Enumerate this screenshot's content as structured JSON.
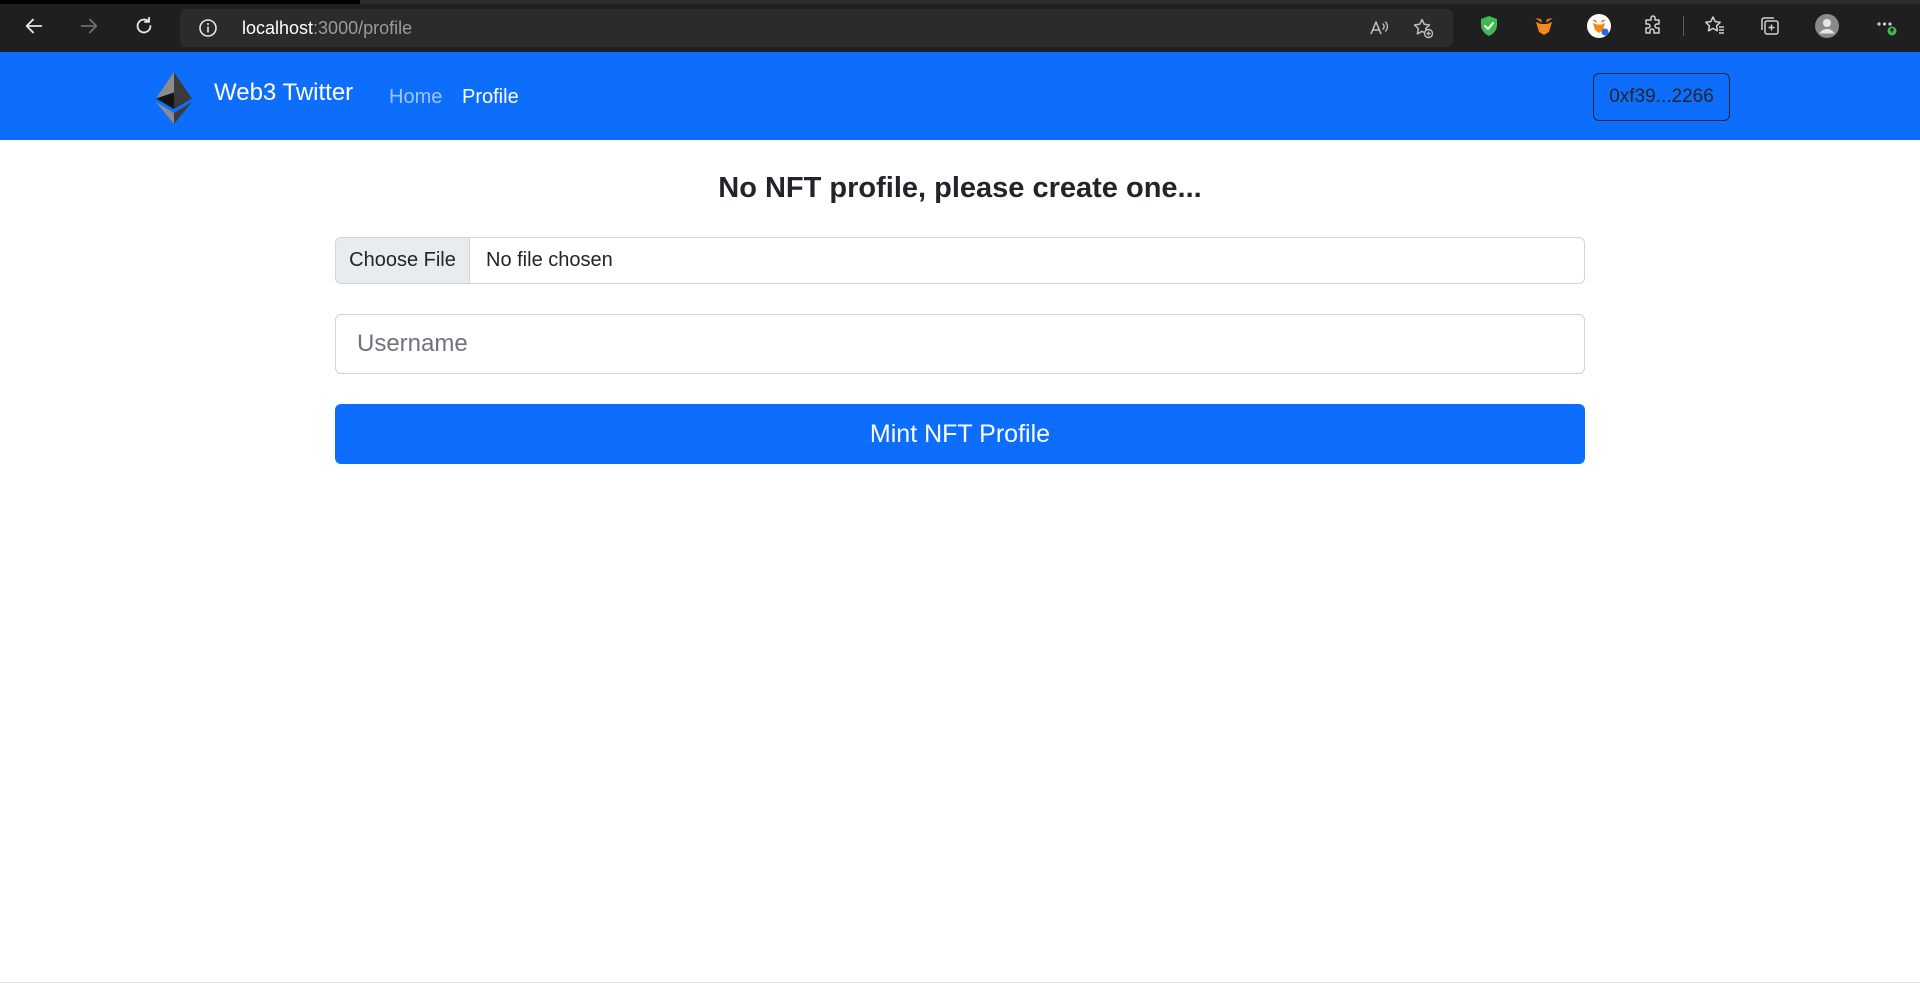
{
  "browser": {
    "url_host": "localhost",
    "url_path": ":3000/profile",
    "icons": [
      "back-icon",
      "forward-icon",
      "reload-icon",
      "site-info-icon",
      "read-aloud-icon",
      "add-favorite-icon",
      "shield-extension-icon",
      "metamask-icon",
      "metamask-account-icon",
      "extensions-icon",
      "favorites-icon",
      "collections-icon",
      "profile-icon",
      "more-icon"
    ]
  },
  "navbar": {
    "brand": "Web3 Twitter",
    "links": [
      {
        "label": "Home"
      },
      {
        "label": "Profile"
      }
    ],
    "wallet": "0xf39...2266",
    "color": "#0d6efd"
  },
  "main": {
    "title": "No NFT profile, please create one...",
    "file_button": "Choose File",
    "file_status": "No file chosen",
    "username_placeholder": "Username",
    "mint_button": "Mint NFT Profile"
  },
  "colors": {
    "primary": "#0d6efd",
    "chrome_bg": "#1f1f1f",
    "text": "#212529"
  }
}
